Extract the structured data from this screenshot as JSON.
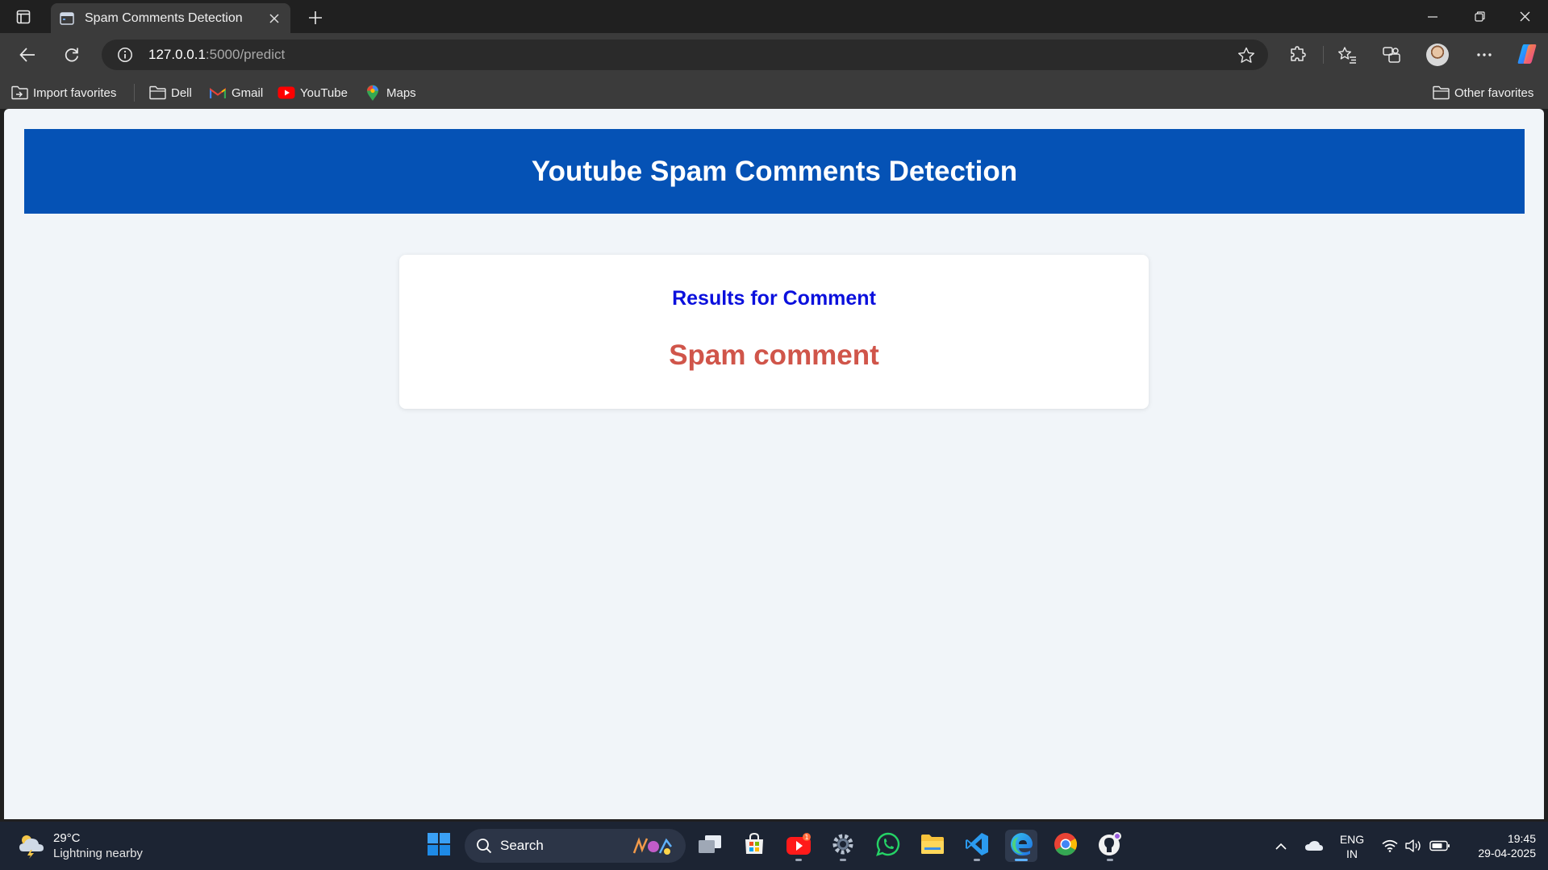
{
  "browser": {
    "tab": {
      "title": "Spam Comments Detection"
    },
    "address_bar": {
      "url_host": "127.0.0.1",
      "url_path": ":5000/predict"
    },
    "favorites": [
      {
        "label": "Import favorites",
        "icon": "import-icon"
      },
      {
        "label": "Dell",
        "icon": "folder-icon"
      },
      {
        "label": "Gmail",
        "icon": "gmail-icon"
      },
      {
        "label": "YouTube",
        "icon": "youtube-icon"
      },
      {
        "label": "Maps",
        "icon": "maps-icon"
      }
    ],
    "other_favorites": {
      "label": "Other favorites",
      "icon": "folder-icon"
    }
  },
  "page": {
    "header_title": "Youtube Spam Comments Detection",
    "result_heading": "Results for Comment",
    "result_value": "Spam comment",
    "colors": {
      "header_bg": "#0552b5",
      "heading_text": "#0b10dd",
      "result_text": "#d0554a",
      "page_bg": "#f1f5f9"
    }
  },
  "taskbar": {
    "weather": {
      "temperature": "29°C",
      "condition": "Lightning nearby"
    },
    "search_label": "Search",
    "apps": [
      "start-icon",
      "task-view-icon",
      "microsoft-store-icon",
      "youtube-app-icon",
      "settings-icon",
      "whatsapp-icon",
      "file-explorer-icon",
      "vscode-icon",
      "edge-icon",
      "chrome-icon",
      "github-icon"
    ],
    "language": {
      "line1": "ENG",
      "line2": "IN"
    },
    "clock": {
      "time": "19:45",
      "date": "29-04-2025"
    }
  }
}
